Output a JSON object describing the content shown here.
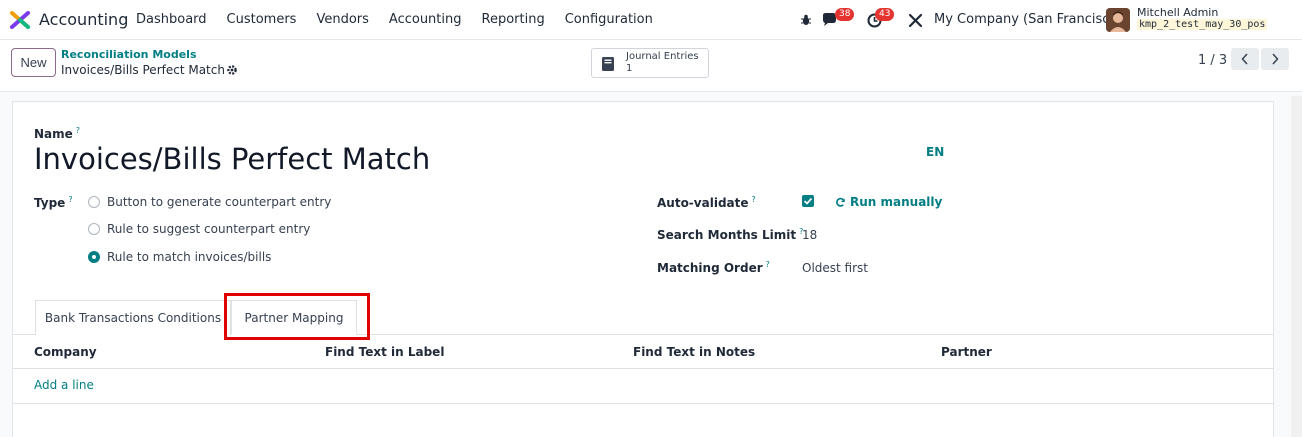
{
  "navbar": {
    "app_name": "Accounting",
    "menu": [
      "Dashboard",
      "Customers",
      "Vendors",
      "Accounting",
      "Reporting",
      "Configuration"
    ],
    "messages_count": "38",
    "activities_count": "43",
    "company": "My Company (San Francisco)",
    "user_name": "Mitchell Admin",
    "database": "kmp_2_test_may_30_pos"
  },
  "control": {
    "new_label": "New",
    "breadcrumb_parent": "Reconciliation Models",
    "breadcrumb_current": "Invoices/Bills Perfect Match",
    "smart_button_label": "Journal Entries",
    "smart_button_value": "1",
    "pager": "1 / 3"
  },
  "form": {
    "name_label": "Name",
    "name_value": "Invoices/Bills Perfect Match",
    "language": "EN",
    "type_label": "Type",
    "type_options": [
      {
        "label": "Button to generate counterpart entry",
        "selected": false
      },
      {
        "label": "Rule to suggest counterpart entry",
        "selected": false
      },
      {
        "label": "Rule to match invoices/bills",
        "selected": true
      }
    ],
    "auto_validate_label": "Auto-validate",
    "auto_validate_checked": true,
    "run_manually_label": "Run manually",
    "search_months_label": "Search Months Limit",
    "search_months_value": "18",
    "matching_order_label": "Matching Order",
    "matching_order_value": "Oldest first",
    "help_marker": "?"
  },
  "notebook": {
    "tabs": [
      "Bank Transactions Conditions",
      "Partner Mapping"
    ],
    "active_tab": "Partner Mapping",
    "columns": [
      "Company",
      "Find Text in Label",
      "Find Text in Notes",
      "Partner"
    ],
    "add_line": "Add a line"
  },
  "colors": {
    "accent": "#017e84",
    "highlight": "#e00000",
    "badge": "#e3342f"
  }
}
